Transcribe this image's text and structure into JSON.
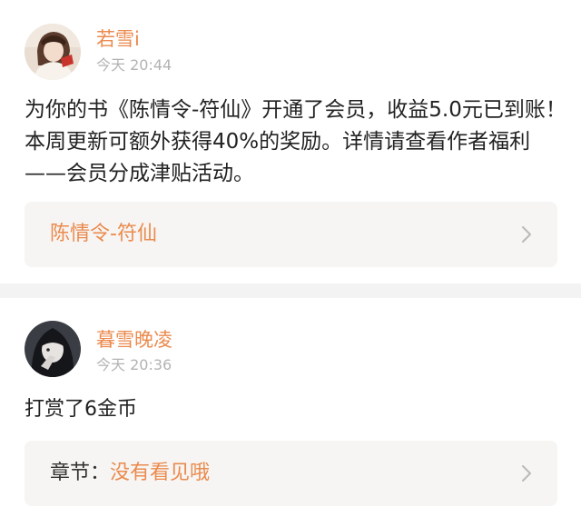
{
  "colors": {
    "accent_orange": "#eb8a4d",
    "text_primary": "#222222",
    "text_muted": "#b3b3b3",
    "link_box_bg": "#f6f5f3",
    "divider_bg": "#f3f3f3"
  },
  "feed": [
    {
      "user": "若雪i",
      "time": "今天 20:44",
      "message": "为你的书《陈情令-符仙》开通了会员，收益5.0元已到账！本周更新可额外获得40%的奖励。详情请查看作者福利——会员分成津贴活动。",
      "link": {
        "prefix": "",
        "title": "陈情令-符仙",
        "icon": "chevron-right-icon"
      }
    },
    {
      "user": "暮雪晚凌",
      "time": "今天 20:36",
      "message": "打赏了6金币",
      "link": {
        "prefix": "章节：",
        "title": "没有看见哦",
        "icon": "chevron-right-icon"
      }
    }
  ]
}
